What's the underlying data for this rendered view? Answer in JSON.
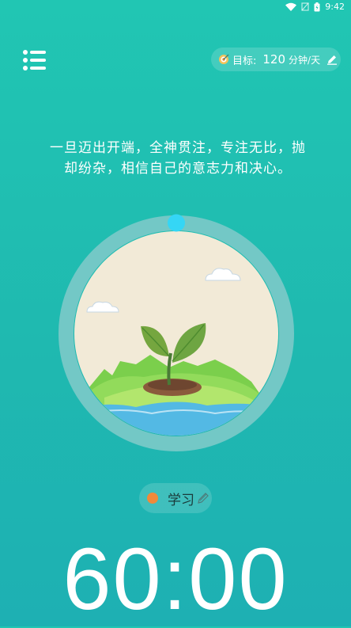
{
  "status_bar": {
    "time": "9:42",
    "icons": [
      "wifi-icon",
      "signal-icon",
      "battery-icon"
    ]
  },
  "header": {
    "menu_icon": "list-menu-icon"
  },
  "goal": {
    "label": "目标:",
    "value": "120",
    "unit": "分钟/天",
    "icon": "target-icon",
    "edit_icon": "pencil-icon"
  },
  "quote": {
    "line1": "一旦迈出开端，全神贯注，专注无比，抛",
    "line2": "却纷杂，相信自己的意志力和决心。"
  },
  "tag": {
    "label": "学习",
    "dot_color": "#f08a3a",
    "edit_icon": "pencil-icon"
  },
  "timer": {
    "display": "60:00",
    "progress": 0
  },
  "colors": {
    "background": "#21c6b3",
    "ring": "#6cc9c7",
    "indicator": "#35d6f5",
    "scene_bg": "#f2ead7"
  }
}
